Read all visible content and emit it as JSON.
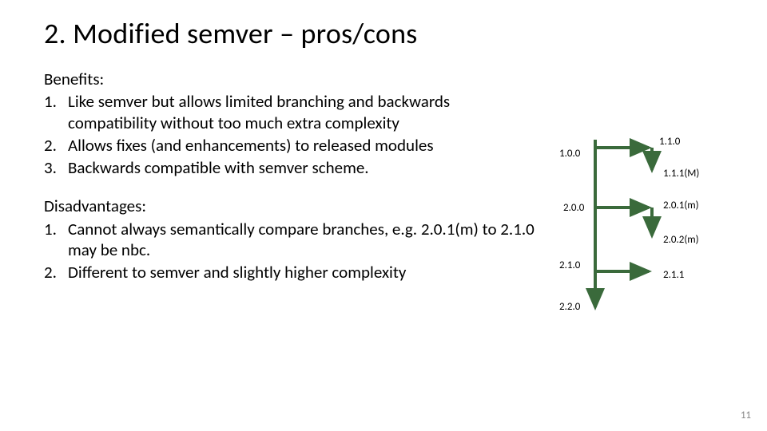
{
  "title": "2. Modified semver – pros/cons",
  "benefits": {
    "label": "Benefits:",
    "items": [
      "Like semver but allows limited branching and backwards compatibility without too much extra complexity",
      "Allows fixes (and enhancements) to released modules",
      "Backwards compatible with semver scheme."
    ]
  },
  "disadvantages": {
    "label": "Disadvantages:",
    "items": [
      "Cannot always semantically compare branches, e.g. 2.0.1(m) to 2.1.0 may be nbc.",
      "Different to semver and slightly higher complexity"
    ]
  },
  "diagram": {
    "nodes": {
      "n100": "1.0.0",
      "n110": "1.1.0",
      "n111M": "1.1.1(M)",
      "n200": "2.0.0",
      "n201m": "2.0.1(m)",
      "n202m": "2.0.2(m)",
      "n210": "2.1.0",
      "n211": "2.1.1",
      "n220": "2.2.0"
    }
  },
  "page_number": "11",
  "colors": {
    "arrow": "#3a6a3b"
  }
}
